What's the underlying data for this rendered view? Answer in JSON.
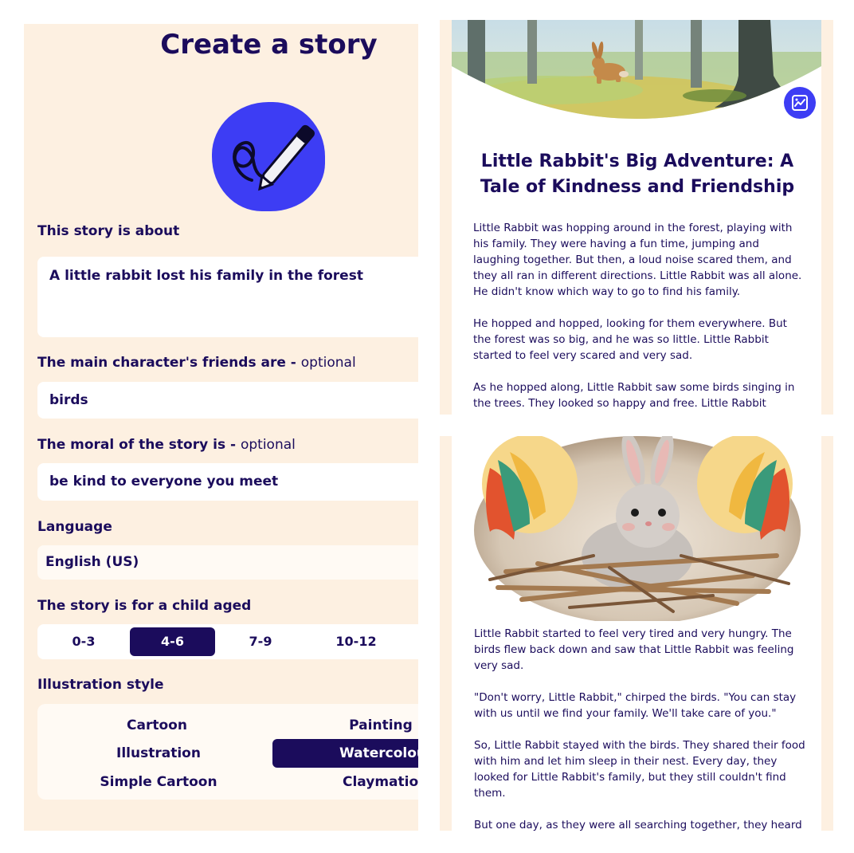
{
  "form": {
    "title": "Create a story",
    "about_label": "This story is about",
    "about_value": "A little rabbit lost his family in the forest",
    "friends_label": "The main character's friends are - ",
    "friends_optional": "optional",
    "friends_value": "birds",
    "moral_label": "The moral of the story is - ",
    "moral_optional": "optional",
    "moral_value": "be kind to everyone you meet",
    "language_label": "Language",
    "language_value": "English (US)",
    "age_label": "The story is for a child aged",
    "ages": [
      "0-3",
      "4-6",
      "7-9",
      "10-12"
    ],
    "selected_age": "4-6",
    "style_label": "Illustration style",
    "styles": [
      "Cartoon",
      "Painting",
      "Illustration",
      "Watercolour",
      "Simple Cartoon",
      "Claymation"
    ],
    "selected_style": "Watercolour"
  },
  "story": {
    "title": "Little Rabbit's Big Adventure: A Tale of Kindness and Friendship",
    "page1": [
      "Little Rabbit was hopping around in the forest, playing with his family. They were having a fun time, jumping and laughing together. But then, a loud noise scared them, and they all ran in different directions. Little Rabbit was all alone. He didn't know which way to go to find his family.",
      "He hopped and hopped, looking for them everywhere. But the forest was so big, and he was so little. Little Rabbit started to feel very scared and very sad.",
      "As he hopped along, Little Rabbit saw some birds singing in the trees. They looked so happy and free. Little Rabbit hopped over to them and asked if they had seen his family."
    ],
    "page2": [
      "Little Rabbit started to feel very tired and very hungry. The birds flew back down and saw that Little Rabbit was feeling very sad.",
      "\"Don't worry, Little Rabbit,\" chirped the birds. \"You can stay with us until we find your family. We'll take care of you.\"",
      "So, Little Rabbit stayed with the birds. They shared their food with him and let him sleep in their nest. Every day, they looked for Little Rabbit's family, but they still couldn't find them.",
      "But one day, as they were all searching together, they heard a familiar noise. Little Rabbit's family had found them! They were so happy to be together again."
    ]
  },
  "icons": {
    "logo": "pen-scribble-icon",
    "image_button": "image-edit-icon"
  },
  "colors": {
    "navy": "#1b0c5c",
    "panel": "#fdf0e1",
    "accent_blue": "#3d3df4"
  }
}
